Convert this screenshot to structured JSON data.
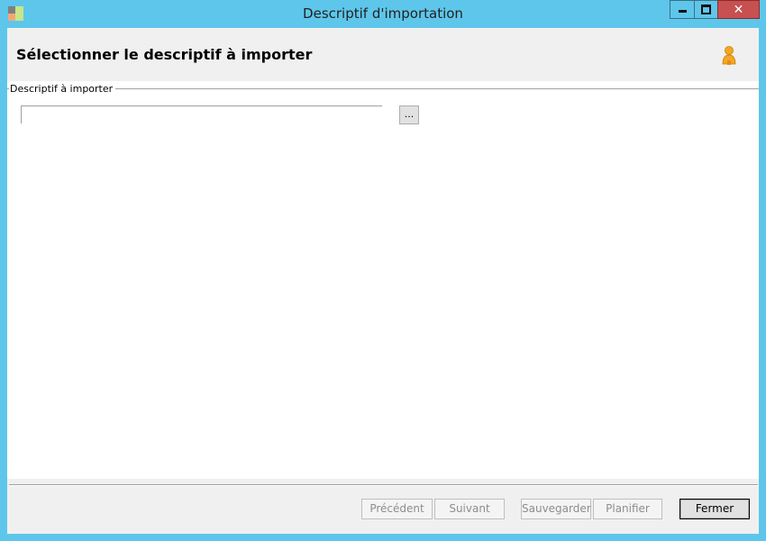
{
  "window": {
    "title": "Descriptif d'importation",
    "app_icon": "app-tiles-icon",
    "controls": {
      "minimize": "minimize-icon",
      "maximize": "maximize-icon",
      "close": "close-icon",
      "close_glyph": "✕"
    }
  },
  "header": {
    "title": "Sélectionner le descriptif à importer",
    "icon": "user-icon"
  },
  "group": {
    "label": "Descriptif à importer",
    "path_value": "",
    "browse_label": "..."
  },
  "buttons": {
    "previous": "Précédent",
    "next": "Suivant",
    "save": "Sauvegarder",
    "schedule": "Planifier",
    "close": "Fermer"
  },
  "colors": {
    "frame": "#5ec6ea",
    "close_button": "#c75050",
    "panel": "#f0f0f0"
  }
}
